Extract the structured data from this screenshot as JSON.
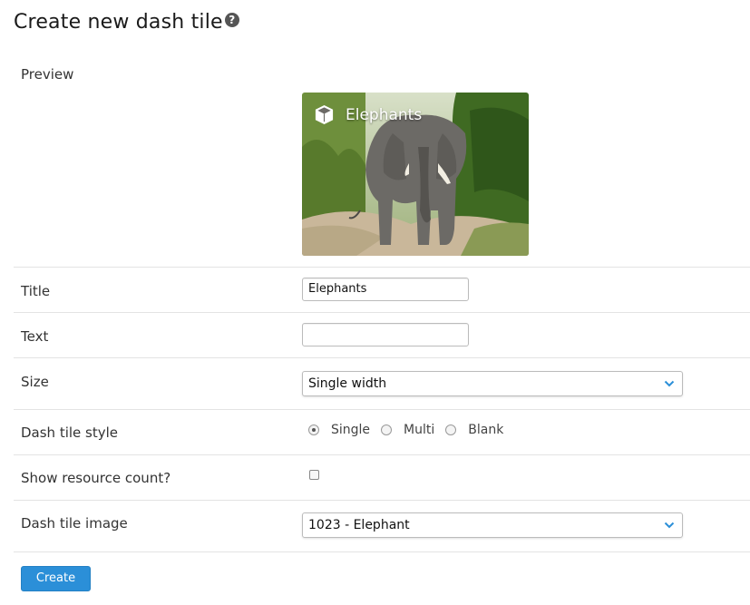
{
  "page": {
    "title": "Create new dash tile",
    "help_icon": "question-circle-icon"
  },
  "form": {
    "preview": {
      "label": "Preview",
      "tile_title": "Elephants",
      "tile_icon": "cube-icon"
    },
    "title": {
      "label": "Title",
      "value": "Elephants"
    },
    "text": {
      "label": "Text",
      "value": ""
    },
    "size": {
      "label": "Size",
      "selected": "Single width"
    },
    "style": {
      "label": "Dash tile style",
      "options": [
        "Single",
        "Multi",
        "Blank"
      ],
      "selected": "Single"
    },
    "resource_count": {
      "label": "Show resource count?",
      "checked": false
    },
    "image": {
      "label": "Dash tile image",
      "selected": "1023 - Elephant"
    },
    "create_label": "Create"
  },
  "colors": {
    "accent": "#2b8fd8",
    "chevron": "#2b8fd8"
  }
}
